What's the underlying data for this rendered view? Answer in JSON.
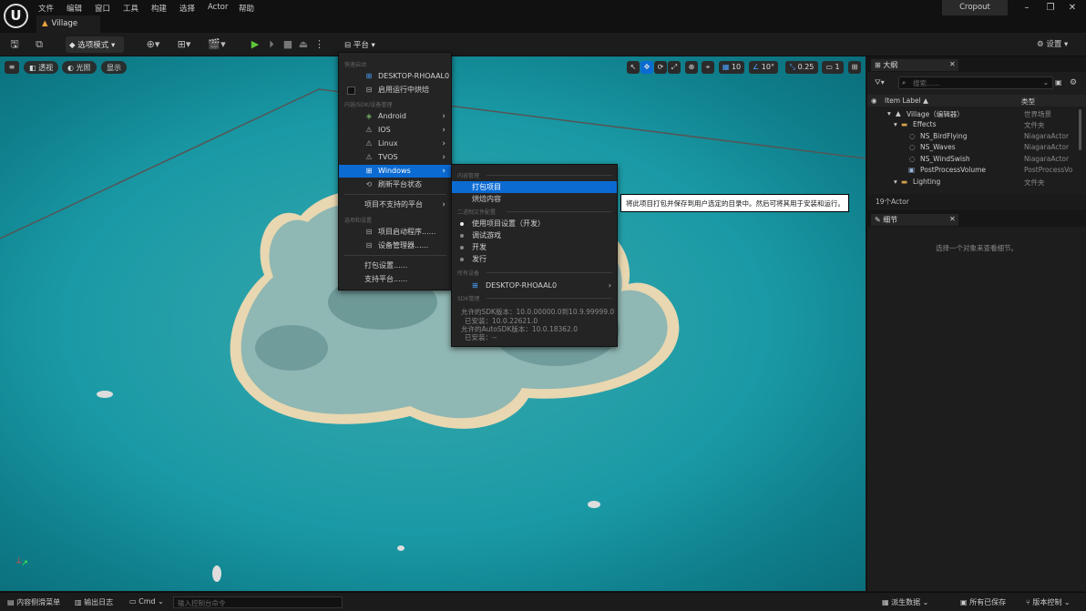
{
  "app": {
    "logo": "U",
    "menus": [
      "文件",
      "编辑",
      "窗口",
      "工具",
      "构建",
      "选择",
      "Actor",
      "帮助"
    ],
    "project_tab": "Village",
    "user": "Cropout"
  },
  "toolbar": {
    "mode": "选项模式",
    "platform": "平台",
    "settings": "设置"
  },
  "viewport": {
    "perspective": "透视",
    "lit": "光照",
    "show": "显示",
    "grid": "10",
    "angle": "10°",
    "scale": "0.25",
    "camera": "1"
  },
  "platform_menu": {
    "sec_quick": "快速启动",
    "device": "DESKTOP-RHOAAL0",
    "bake": "启用运行中烘焙",
    "sec_sdk": "内容/SDK/设备管理",
    "platforms": [
      "Android",
      "IOS",
      "Linux",
      "TVOS",
      "Windows"
    ],
    "refresh": "刷新平台状态",
    "unsupported": "项目不支持的平台",
    "sec_options": "选项和设置",
    "launcher": "项目启动程序......",
    "device_mgr": "设备管理器......",
    "pkg_settings": "打包设置......",
    "supported": "支持平台......"
  },
  "windows_menu": {
    "sec_content": "内容管理",
    "package": "打包项目",
    "cook": "烘焙内容",
    "sec_binary": "二进制文件配置",
    "configs": [
      "使用项目设置（开发）",
      "调试游戏",
      "开发",
      "发行"
    ],
    "sec_devices": "所有设备",
    "device": "DESKTOP-RHOAAL0",
    "sec_sdk": "SDK管理",
    "sdk_lines": [
      "允许的SDK版本：10.0.00000.0到10.9.99999.0",
      "已安装：10.0.22621.0",
      "允许的AutoSDK版本：10.0.18362.0",
      "已安装：--"
    ]
  },
  "tooltip": "将此项目打包并保存到用户选定的目录中。然后可将其用于安装和运行。",
  "outliner": {
    "tab": "大纲",
    "search": "搜索......",
    "col_label": "Item Label ▲",
    "col_type": "类型",
    "rows": [
      {
        "name": "Village（编辑器）",
        "type": "世界场景"
      },
      {
        "name": "Effects",
        "type": "文件夹"
      },
      {
        "name": "NS_BirdFlying",
        "type": "NiagaraActor"
      },
      {
        "name": "NS_Waves",
        "type": "NiagaraActor"
      },
      {
        "name": "NS_WindSwish",
        "type": "NiagaraActor"
      },
      {
        "name": "PostProcessVolume",
        "type": "PostProcessVo"
      },
      {
        "name": "Lighting",
        "type": "文件夹"
      }
    ],
    "count": "19个Actor"
  },
  "details": {
    "tab": "细节",
    "hint": "选择一个对象来查看细节。"
  },
  "bottom": {
    "drawer": "内容侧滑菜单",
    "log": "输出日志",
    "cmd": "Cmd",
    "console_placeholder": "输入控制台命令",
    "derived": "派生数据",
    "saved": "所有已保存",
    "vc": "版本控制"
  }
}
